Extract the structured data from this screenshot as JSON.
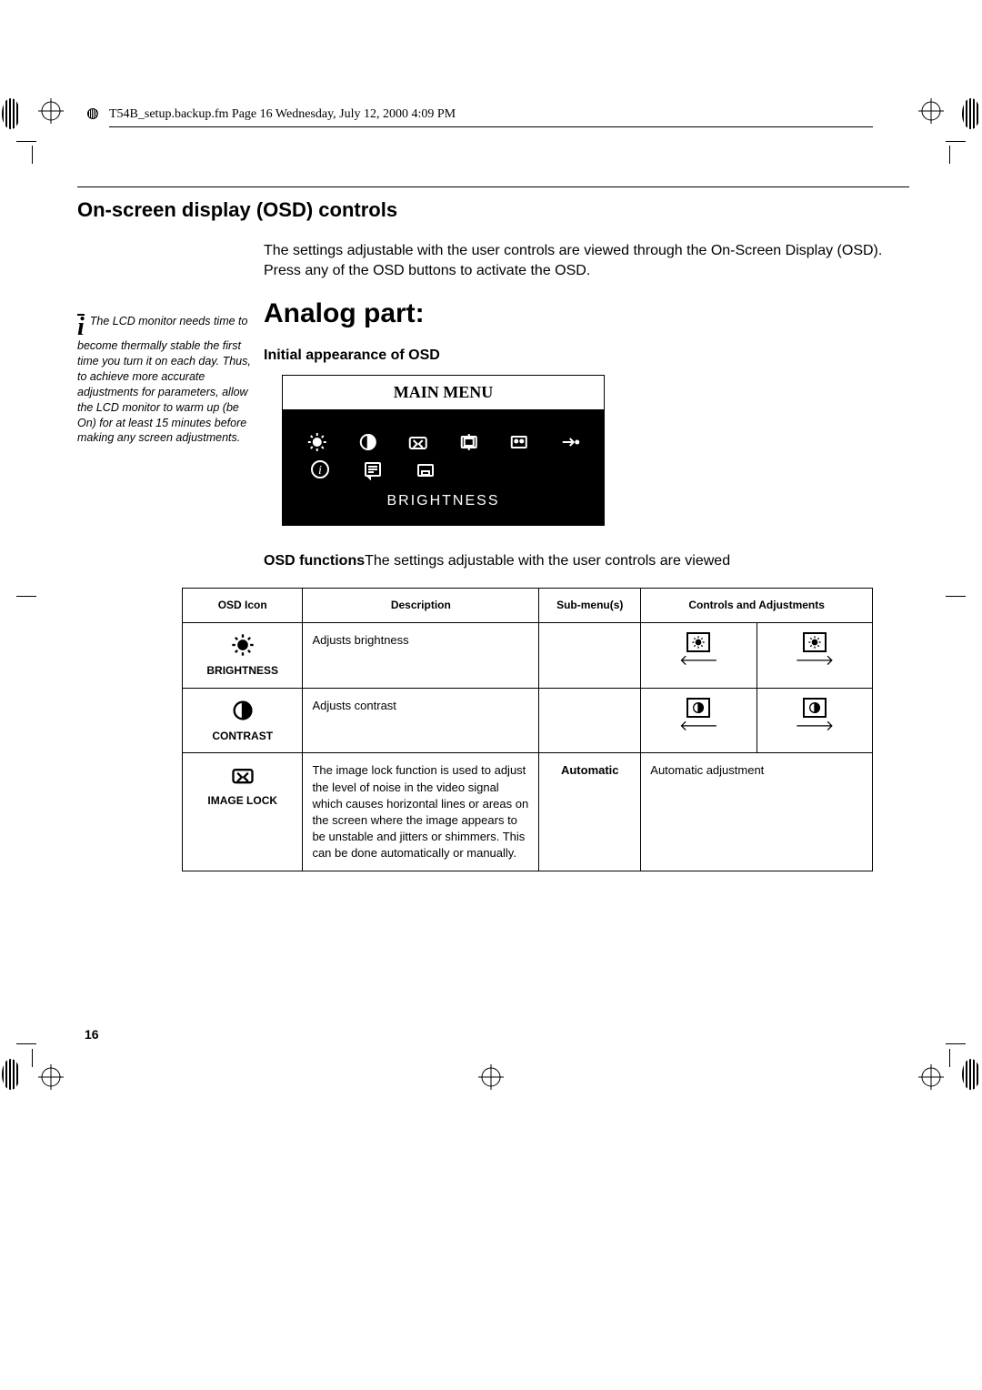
{
  "fm_bar": "T54B_setup.backup.fm   Page 16   Wednesday, July 12, 2000   4:09 PM",
  "section_title": "On-screen display (OSD) controls",
  "intro": "The settings adjustable with the user controls are viewed through the On-Screen Display (OSD). Press any of the OSD buttons to activate the OSD.",
  "analog_heading": "Analog part:",
  "initial_heading": "Initial appearance of OSD",
  "sidebar_note": "The LCD monitor needs time to become thermally stable the first time you turn it on each day. Thus, to achieve more accurate adjustments for parameters, allow the LCD monitor to warm up (be On) for at least 15 minutes before making any screen adjustments.",
  "osd_preview": {
    "title": "MAIN MENU",
    "row1": [
      {
        "name": "brightness-icon",
        "svg": "sun"
      },
      {
        "name": "contrast-icon",
        "svg": "contrast"
      },
      {
        "name": "image-lock-icon",
        "svg": "imagelock"
      },
      {
        "name": "image-position-icon",
        "svg": "imagepos"
      },
      {
        "name": "image-setup-icon",
        "svg": "setup"
      },
      {
        "name": "exit-icon",
        "svg": "exit"
      }
    ],
    "row2": [
      {
        "name": "information-icon",
        "svg": "info"
      },
      {
        "name": "language-icon",
        "svg": "language"
      },
      {
        "name": "reset-icon",
        "svg": "reset"
      }
    ],
    "selected_label": "BRIGHTNESS"
  },
  "fn_line_bold": "OSD functions",
  "fn_line_rest": "The settings adjustable with the user controls are viewed",
  "table": {
    "headers": [
      "OSD Icon",
      "Description",
      "Sub-menu(s)",
      "Controls and Adjustments"
    ],
    "rows": [
      {
        "icon": "sun",
        "icon_label": "BRIGHTNESS",
        "desc": "Adjusts brightness",
        "sub": "",
        "controls_type": "arrows",
        "ctrl_icon": "sun"
      },
      {
        "icon": "contrast",
        "icon_label": "CONTRAST",
        "desc": "Adjusts contrast",
        "sub": "",
        "controls_type": "arrows",
        "ctrl_icon": "contrast"
      },
      {
        "icon": "imagelock",
        "icon_label": "IMAGE LOCK",
        "desc": "The image lock function is used to adjust the level of noise in the video signal which causes horizontal lines or areas on the screen where the image appears to be unstable and jitters or shimmers. This can be done automatically or manually.",
        "sub": "Automatic",
        "controls_type": "text",
        "controls_text": "Automatic adjustment"
      }
    ]
  },
  "page_number": "16"
}
